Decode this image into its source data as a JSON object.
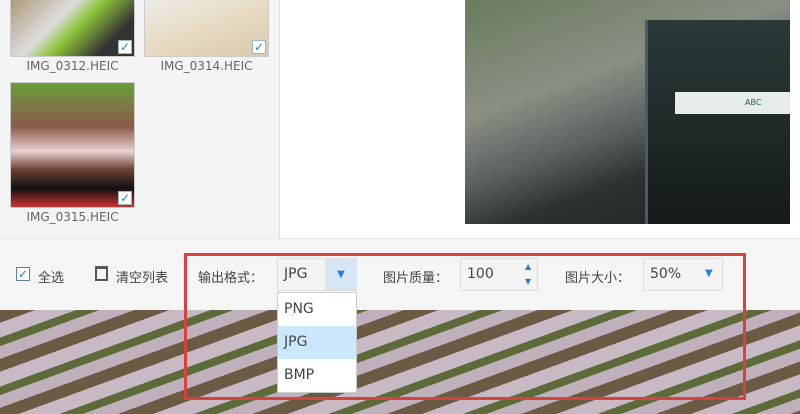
{
  "thumbnails": [
    {
      "name": "IMG_0312.HEIC",
      "checked": true
    },
    {
      "name": "IMG_0314.HEIC",
      "checked": true
    },
    {
      "name": "IMG_0315.HEIC",
      "checked": true
    }
  ],
  "preview": {
    "sign_text": "ABC"
  },
  "toolbar": {
    "select_all": "全选",
    "clear_list": "清空列表",
    "format_label": "输出格式：",
    "format_value": "JPG",
    "format_options": [
      "PNG",
      "JPG",
      "BMP"
    ],
    "quality_label": "图片质量：",
    "quality_value": "100",
    "size_label": "图片大小：",
    "size_value": "50%"
  },
  "colors": {
    "highlight": "#d9413f",
    "accent": "#2b7fd4",
    "selected_option": "#cce8ff"
  }
}
